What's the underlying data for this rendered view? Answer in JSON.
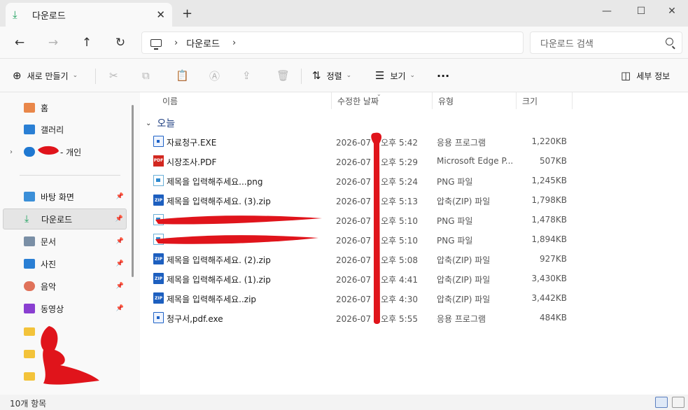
{
  "tab": {
    "title": "다운로드",
    "close_glyph": "✕",
    "new_tab_glyph": "+"
  },
  "window": {
    "minimize": "—",
    "maximize": "☐",
    "close": "✕"
  },
  "nav": {
    "back": "←",
    "forward": "→",
    "up": "↑",
    "refresh": "↻",
    "breadcrumb": [
      "다운로드"
    ],
    "search_placeholder": "다운로드 검색"
  },
  "toolbar": {
    "new_label": "새로 만들기",
    "sort_label": "정렬",
    "view_label": "보기",
    "more_label": "···",
    "details_label": "세부 정보"
  },
  "sidebar": {
    "home": "홈",
    "gallery": "갤러리",
    "onedrive": "- 개인",
    "desktop": "바탕 화면",
    "downloads": "다운로드",
    "documents": "문서",
    "pictures": "사진",
    "music": "음악",
    "videos": "동영상"
  },
  "columns": {
    "name": "이름",
    "date": "수정한 날짜",
    "type": "유형",
    "size": "크기"
  },
  "group_label": "오늘",
  "files": [
    {
      "name": "자료청구.EXE",
      "date": "2026-07",
      "time": "오후 5:42",
      "type": "응용 프로그램",
      "size": "1,220KB",
      "icon": "exe"
    },
    {
      "name": "시장조사.PDF",
      "date": "2026-07",
      "time": "오후 5:29",
      "type": "Microsoft Edge P...",
      "size": "507KB",
      "icon": "pdf"
    },
    {
      "name": "제목을 입력해주세요...png",
      "date": "2026-07",
      "time": "오후 5:24",
      "type": "PNG 파일",
      "size": "1,245KB",
      "icon": "img"
    },
    {
      "name": "제목을 입력해주세요. (3).zip",
      "date": "2026-07",
      "time": "오후 5:13",
      "type": "압축(ZIP) 파일",
      "size": "1,798KB",
      "icon": "zip"
    },
    {
      "name": "",
      "date": "2026-07",
      "time": "오후 5:10",
      "type": "PNG 파일",
      "size": "1,478KB",
      "icon": "img"
    },
    {
      "name": "",
      "date": "2026-07",
      "time": "오후 5:10",
      "type": "PNG 파일",
      "size": "1,894KB",
      "icon": "img"
    },
    {
      "name": "제목을 입력해주세요. (2).zip",
      "date": "2026-07",
      "time": "오후 5:08",
      "type": "압축(ZIP) 파일",
      "size": "927KB",
      "icon": "zip"
    },
    {
      "name": "제목을 입력해주세요. (1).zip",
      "date": "2026-07",
      "time": "오후 4:41",
      "type": "압축(ZIP) 파일",
      "size": "3,430KB",
      "icon": "zip"
    },
    {
      "name": "제목을 입력해주세요..zip",
      "date": "2026-07",
      "time": "오후 4:30",
      "type": "압축(ZIP) 파일",
      "size": "3,442KB",
      "icon": "zip"
    },
    {
      "name": "청구서,pdf.exe",
      "date": "2026-07",
      "time": "오후 5:55",
      "type": "응용 프로그램",
      "size": "484KB",
      "icon": "exe"
    }
  ],
  "status": {
    "item_count": "10개 항목"
  },
  "colors": {
    "accent": "#1f3f80",
    "download_green": "#19a05b",
    "scribble_red": "#e0141b"
  }
}
